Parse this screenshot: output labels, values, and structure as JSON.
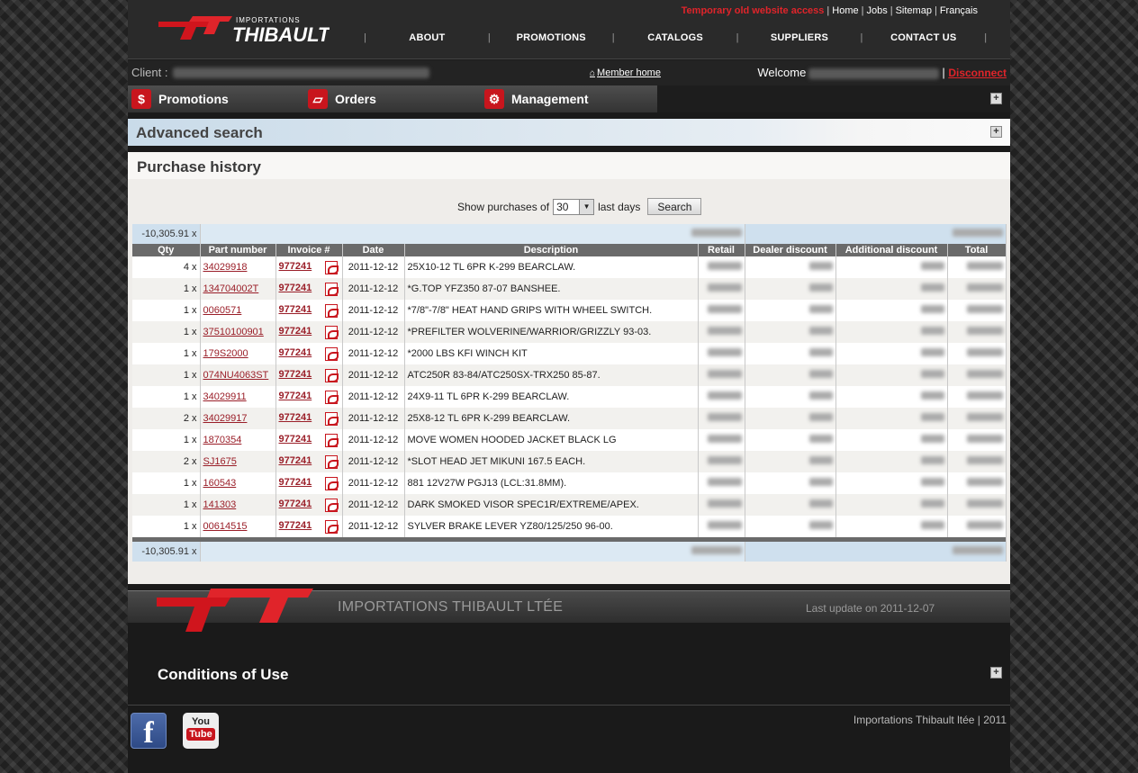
{
  "header": {
    "brand_small": "IMPORTATIONS",
    "brand_big": "THIBAULT",
    "old_site": "Temporary old website access",
    "toplinks": [
      "Home",
      "Jobs",
      "Sitemap",
      "Français"
    ],
    "nav": [
      "ABOUT",
      "PROMOTIONS",
      "CATALOGS",
      "SUPPLIERS",
      "CONTACT US"
    ]
  },
  "clientbar": {
    "client_label": "Client :",
    "member_home": "Member home",
    "welcome": "Welcome",
    "disconnect": "Disconnect"
  },
  "membermenu": {
    "items": [
      {
        "label": "Promotions",
        "icon": "dollar-icon",
        "glyph": "$"
      },
      {
        "label": "Orders",
        "icon": "eraser-icon",
        "glyph": "▱"
      },
      {
        "label": "Management",
        "icon": "gear-icon",
        "glyph": "⚙"
      }
    ]
  },
  "advanced_search": {
    "title": "Advanced search"
  },
  "history": {
    "title": "Purchase history",
    "filter": {
      "prefix": "Show purchases of",
      "value": "30",
      "suffix": "last days",
      "button": "Search"
    },
    "summary_top": "-10,305.91 x",
    "summary_bottom": "-10,305.91 x",
    "columns": [
      "Qty",
      "Part number",
      "Invoice #",
      "Date",
      "Description",
      "Retail",
      "Dealer discount",
      "Additional discount",
      "Total"
    ],
    "rows": [
      {
        "qty": "4 x",
        "part": "34029918",
        "invoice": "977241",
        "date": "2011-12-12",
        "desc": "25X10-12 TL 6PR K-299 BEARCLAW."
      },
      {
        "qty": "1 x",
        "part": "134704002T",
        "invoice": "977241",
        "date": "2011-12-12",
        "desc": "*G.TOP YFZ350 87-07 BANSHEE."
      },
      {
        "qty": "1 x",
        "part": "0060571",
        "invoice": "977241",
        "date": "2011-12-12",
        "desc": "*7/8\"-7/8\" HEAT HAND GRIPS WITH WHEEL SWITCH."
      },
      {
        "qty": "1 x",
        "part": "37510100901",
        "invoice": "977241",
        "date": "2011-12-12",
        "desc": "*PREFILTER WOLVERINE/WARRIOR/GRIZZLY 93-03."
      },
      {
        "qty": "1 x",
        "part": "179S2000",
        "invoice": "977241",
        "date": "2011-12-12",
        "desc": "*2000 LBS KFI WINCH KIT"
      },
      {
        "qty": "1 x",
        "part": "074NU4063ST",
        "invoice": "977241",
        "date": "2011-12-12",
        "desc": "ATC250R 83-84/ATC250SX-TRX250 85-87."
      },
      {
        "qty": "1 x",
        "part": "34029911",
        "invoice": "977241",
        "date": "2011-12-12",
        "desc": "24X9-11 TL 6PR K-299 BEARCLAW."
      },
      {
        "qty": "2 x",
        "part": "34029917",
        "invoice": "977241",
        "date": "2011-12-12",
        "desc": "25X8-12 TL 6PR K-299 BEARCLAW."
      },
      {
        "qty": "1 x",
        "part": "1870354",
        "invoice": "977241",
        "date": "2011-12-12",
        "desc": "MOVE WOMEN HOODED JACKET BLACK LG"
      },
      {
        "qty": "2 x",
        "part": "SJ1675",
        "invoice": "977241",
        "date": "2011-12-12",
        "desc": "*SLOT HEAD JET MIKUNI 167.5 EACH."
      },
      {
        "qty": "1 x",
        "part": "160543",
        "invoice": "977241",
        "date": "2011-12-12",
        "desc": "881 12V27W PGJ13 (LCL:31.8MM)."
      },
      {
        "qty": "1 x",
        "part": "141303",
        "invoice": "977241",
        "date": "2011-12-12",
        "desc": "DARK SMOKED VISOR SPEC1R/EXTREME/APEX."
      },
      {
        "qty": "1 x",
        "part": "00614515",
        "invoice": "977241",
        "date": "2011-12-12",
        "desc": "SYLVER BRAKE LEVER YZ80/125/250 96-00."
      }
    ]
  },
  "footer": {
    "company": "IMPORTATIONS THIBAULT LTÉE",
    "last_update": "Last update on 2011-12-07",
    "conditions": "Conditions of Use",
    "facebook_glyph": "f",
    "youtube_you": "You",
    "youtube_tube": "Tube",
    "copyright": "Importations Thibault ltée | 2011"
  },
  "colors": {
    "accent": "#e0242a",
    "link": "#9a1e28",
    "summary": "#cfe0ee"
  }
}
